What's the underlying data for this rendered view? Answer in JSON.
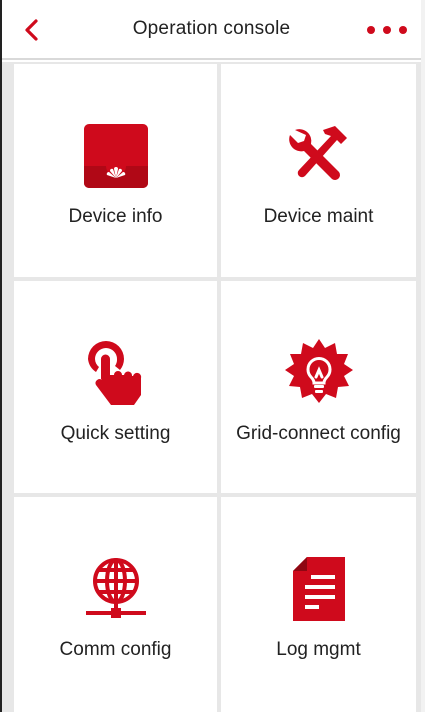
{
  "header": {
    "title": "Operation console",
    "back_icon": "chevron-left-icon",
    "more_icon": "more-dots-icon"
  },
  "tiles": [
    {
      "label": "Device info",
      "icon": "device-info-icon"
    },
    {
      "label": "Device maint",
      "icon": "tools-icon"
    },
    {
      "label": "Quick setting",
      "icon": "touch-icon"
    },
    {
      "label": "Grid-connect config",
      "icon": "bulb-icon"
    },
    {
      "label": "Comm config",
      "icon": "network-globe-icon"
    },
    {
      "label": "Log mgmt",
      "icon": "document-icon"
    }
  ],
  "colors": {
    "accent": "#cf0a1c",
    "text": "#222222",
    "grid_gap": "#e7e7e7"
  }
}
